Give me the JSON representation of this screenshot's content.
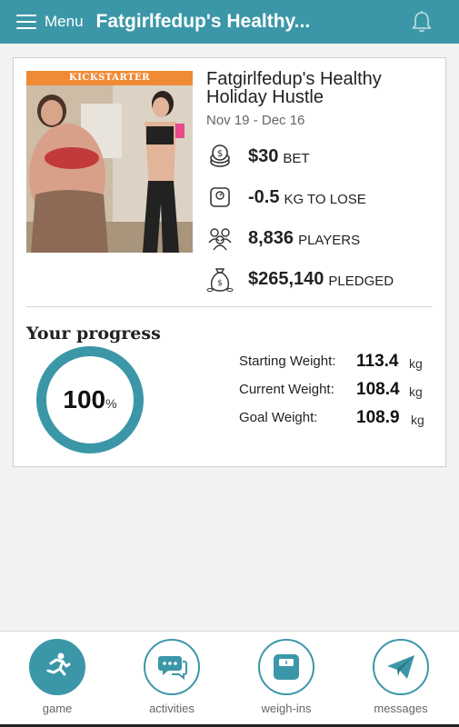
{
  "header": {
    "menu_label": "Menu",
    "title": "Fatgirlfedup's Healthy...",
    "bell_icon": "bell-icon"
  },
  "game": {
    "promo_banner": "KICKSTARTER",
    "title": "Fatgirlfedup's Healthy Holiday Hustle",
    "dates": "Nov 19 - Dec 16",
    "stats": [
      {
        "icon": "coins-icon",
        "value": "$30",
        "unit": "BET"
      },
      {
        "icon": "scale-icon",
        "value": "-0.5",
        "unit": "KG TO LOSE"
      },
      {
        "icon": "players-icon",
        "value": "8,836",
        "unit": "PLAYERS"
      },
      {
        "icon": "money-bag-icon",
        "value": "$265,140",
        "unit": "PLEDGED"
      }
    ]
  },
  "progress": {
    "title": "Your progress",
    "percent": "100",
    "percent_sign": "%",
    "weights": [
      {
        "label": "Starting Weight:",
        "value": "113.4",
        "unit": "kg"
      },
      {
        "label": "Current Weight:",
        "value": "108.4",
        "unit": "kg"
      },
      {
        "label": "Goal Weight:",
        "value": "108.9",
        "unit": "kg"
      }
    ]
  },
  "nav": [
    {
      "label": "game",
      "icon": "runner-icon",
      "active": true
    },
    {
      "label": "activities",
      "icon": "chat-bubbles-icon",
      "active": false
    },
    {
      "label": "weigh-ins",
      "icon": "scale-icon",
      "active": false
    },
    {
      "label": "messages",
      "icon": "paper-plane-icon",
      "active": false
    }
  ],
  "colors": {
    "accent": "#3b97a8",
    "banner": "#f08a35"
  }
}
